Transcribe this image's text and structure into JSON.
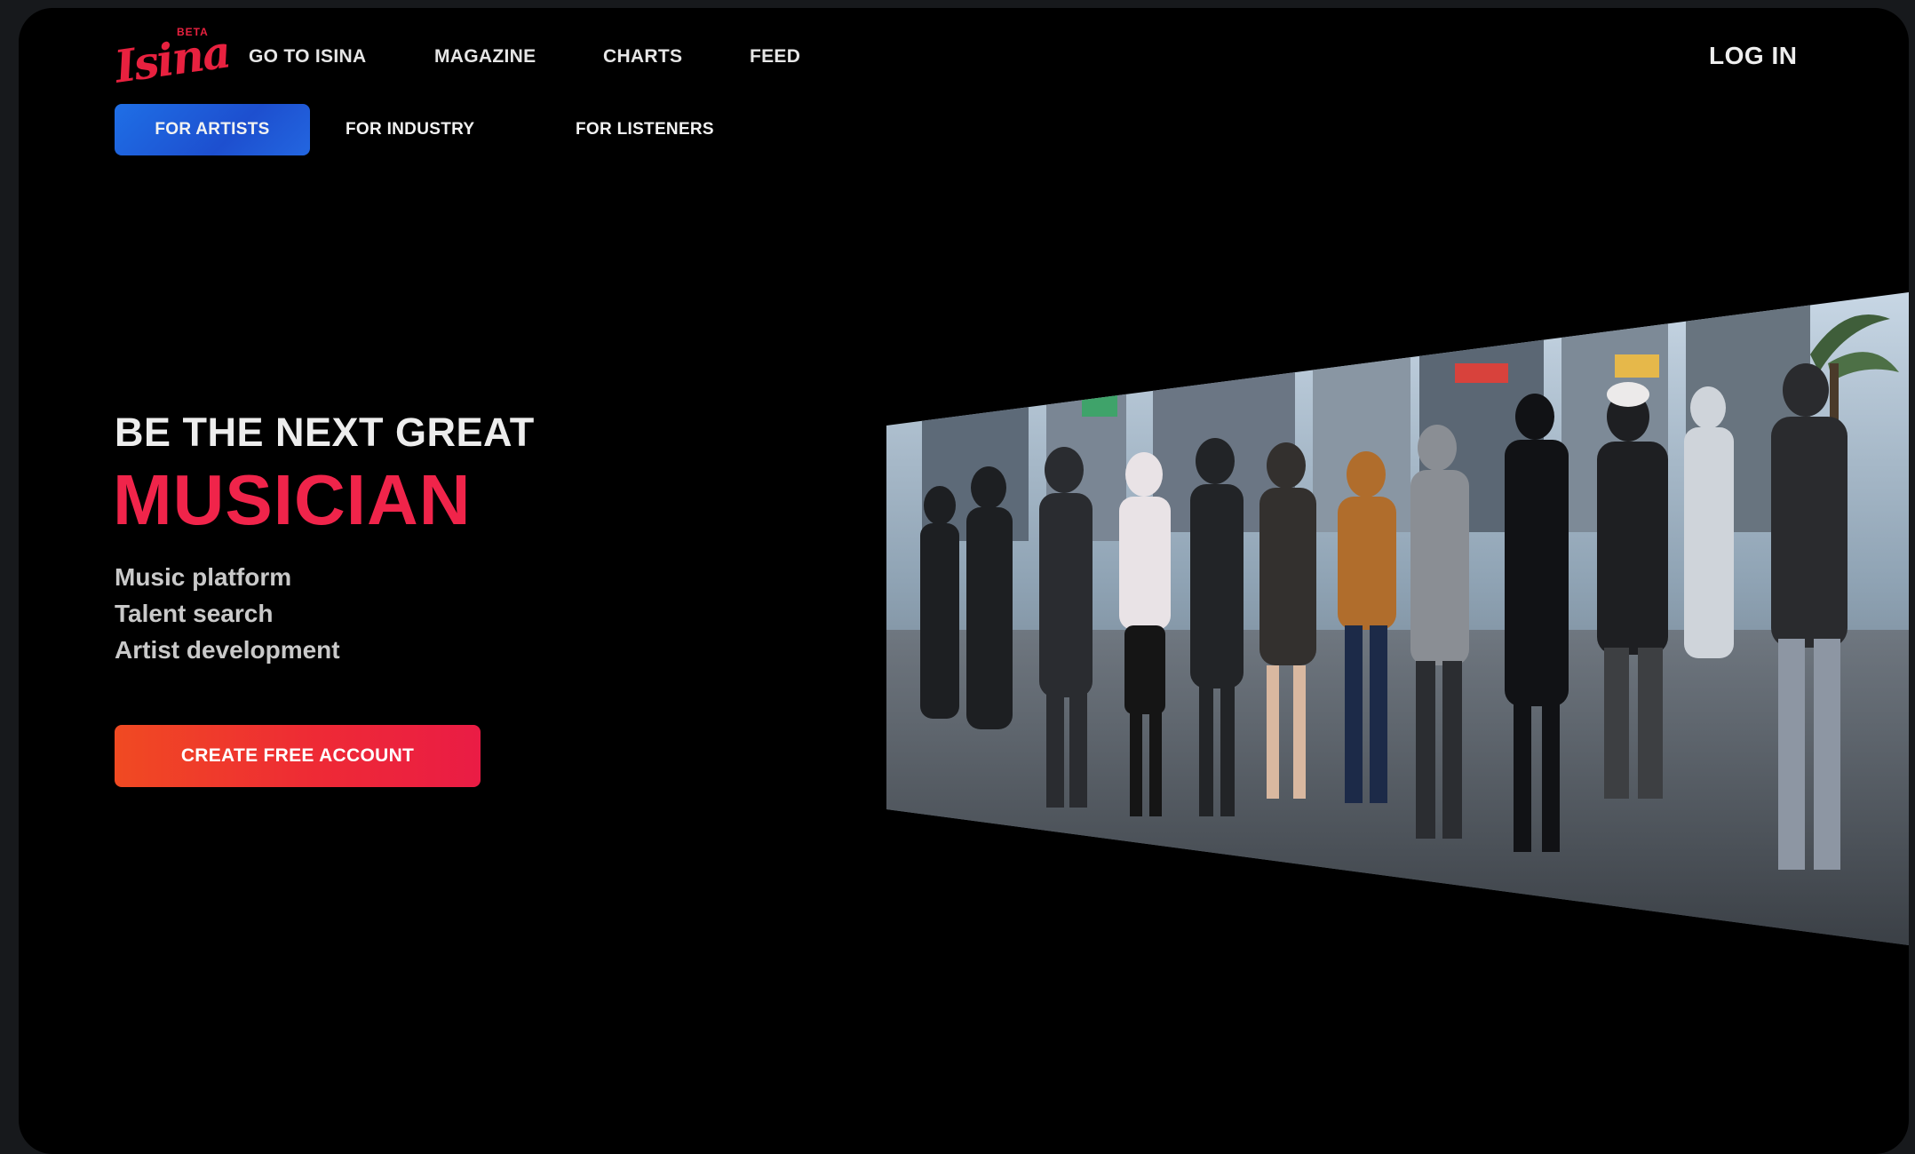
{
  "brand": {
    "logo_text": "Isina",
    "badge": "BETA",
    "color": "#e8213f"
  },
  "nav": {
    "links": [
      {
        "label": "GO TO ISINA"
      },
      {
        "label": "MAGAZINE"
      },
      {
        "label": "CHARTS"
      },
      {
        "label": "FEED"
      }
    ],
    "login_label": "LOG IN"
  },
  "tabs": {
    "items": [
      {
        "label": "FOR ARTISTS",
        "active": true
      },
      {
        "label": "FOR INDUSTRY",
        "active": false
      },
      {
        "label": "FOR LISTENERS",
        "active": false
      }
    ],
    "active_color": "#1f5fdd"
  },
  "hero": {
    "line1": "BE THE NEXT GREAT",
    "line2": "MUSICIAN",
    "features": [
      "Music platform",
      "Talent search",
      "Artist development"
    ],
    "cta_label": "CREATE FREE ACCOUNT",
    "accent_color": "#f0244a"
  },
  "media": {
    "icon": "street-crowd-video"
  }
}
